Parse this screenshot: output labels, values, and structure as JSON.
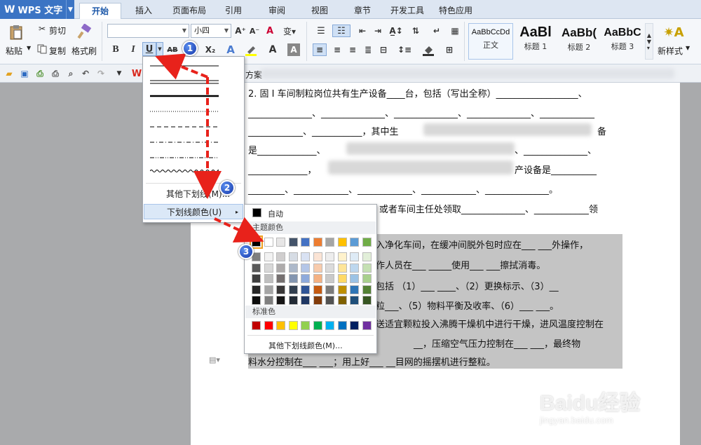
{
  "app": {
    "name": "WPS 文字",
    "logo": "W"
  },
  "tabs": [
    "开始",
    "插入",
    "页面布局",
    "引用",
    "审阅",
    "视图",
    "章节",
    "开发工具",
    "特色应用"
  ],
  "ribbon": {
    "paste": "粘贴",
    "cut": "剪切",
    "copy": "复制",
    "format_painter": "格式刷",
    "font_name": "",
    "font_size": "小四",
    "bold": "B",
    "italic": "I",
    "underline": "U",
    "highlight_label": "AB",
    "subscript": "X₂",
    "styles": [
      {
        "preview": "AaBbCcDd",
        "name": "正文"
      },
      {
        "preview": "AaBl",
        "name": "标题 1"
      },
      {
        "preview": "AaBb(",
        "name": "标题 2"
      },
      {
        "preview": "AaBbC",
        "name": "标题 3"
      }
    ],
    "new_style": "新样式"
  },
  "quick_access": {
    "partial_label": "方案"
  },
  "underline_menu": {
    "more_underlines": "其他下划线(M)...",
    "underline_color": "下划线颜色(U)"
  },
  "color_menu": {
    "auto": "自动",
    "theme_header": "主题颜色",
    "standard_header": "标准色",
    "more_colors": "其他下划线颜色(M)...",
    "theme_colors": [
      "#000000",
      "#ffffff",
      "#e7e6e6",
      "#44546a",
      "#4472c4",
      "#ed7d31",
      "#a5a5a5",
      "#ffc000",
      "#5b9bd5",
      "#70ad47"
    ],
    "shade_grid": [
      [
        "#7f7f7f",
        "#f2f2f2",
        "#d0cece",
        "#d6dce4",
        "#d9e2f3",
        "#fbe4d5",
        "#ededed",
        "#fff2cc",
        "#deebf6",
        "#e2efd9"
      ],
      [
        "#595959",
        "#d8d8d8",
        "#aeabab",
        "#adb9ca",
        "#b4c6e7",
        "#f7cbac",
        "#dbdbdb",
        "#fee599",
        "#bdd7ee",
        "#c5e0b3"
      ],
      [
        "#3f3f3f",
        "#bfbfbf",
        "#757070",
        "#8496b0",
        "#8eaadb",
        "#f4b183",
        "#c9c9c9",
        "#ffd966",
        "#9cc3e5",
        "#a8d08d"
      ],
      [
        "#262626",
        "#a5a5a5",
        "#3a3838",
        "#323f4f",
        "#2f5496",
        "#c55a11",
        "#7b7b7b",
        "#bf8f00",
        "#2e75b5",
        "#538135"
      ],
      [
        "#0c0c0c",
        "#7f7f7f",
        "#171616",
        "#222a35",
        "#1f3763",
        "#833c0b",
        "#525252",
        "#7f6000",
        "#1e4e79",
        "#375623"
      ]
    ],
    "standard_colors": [
      "#c00000",
      "#ff0000",
      "#ffc000",
      "#ffff00",
      "#92d050",
      "#00b050",
      "#00b0f0",
      "#0070c0",
      "#002060",
      "#7030a0"
    ]
  },
  "badges": [
    "1",
    "2",
    "3"
  ],
  "document": {
    "lines": [
      "2. 固 I 车间制粒岗位共有生产设备____台，包括（写出全称）__________________、",
      "______________、______________、______________、______________、____________",
      "____________、___________，其中生",
      "备",
      "是_____________、",
      "、______________、",
      "_____________，",
      "产设备是__________",
      "________、____________、____________、____________、______________。",
      "3. 生产前，操作人员需要去 QA 或者车间主任处领取______________、____________领",
      "入净化车间，在缓冲间脱外包时应在___      ___外操作，",
      "作人员在___        _____使用___       ___擦拭消毒。",
      "包括 （1）___               ____、（2）更换标示、（3）__",
      "粒___、（5）物料平衡及收率、（6）___        ___。",
      "送适宜颗粒投入沸腾干燥机中进行干燥，进风温度控制在",
      "__，压缩空气压力控制在___          ___，最终物",
      "料水分控制在___     ___；用上好___    __目网的摇摆机进行整粒。"
    ]
  },
  "watermark": {
    "brand": "Baidu经验",
    "url": "jingyan.baidu.com"
  }
}
